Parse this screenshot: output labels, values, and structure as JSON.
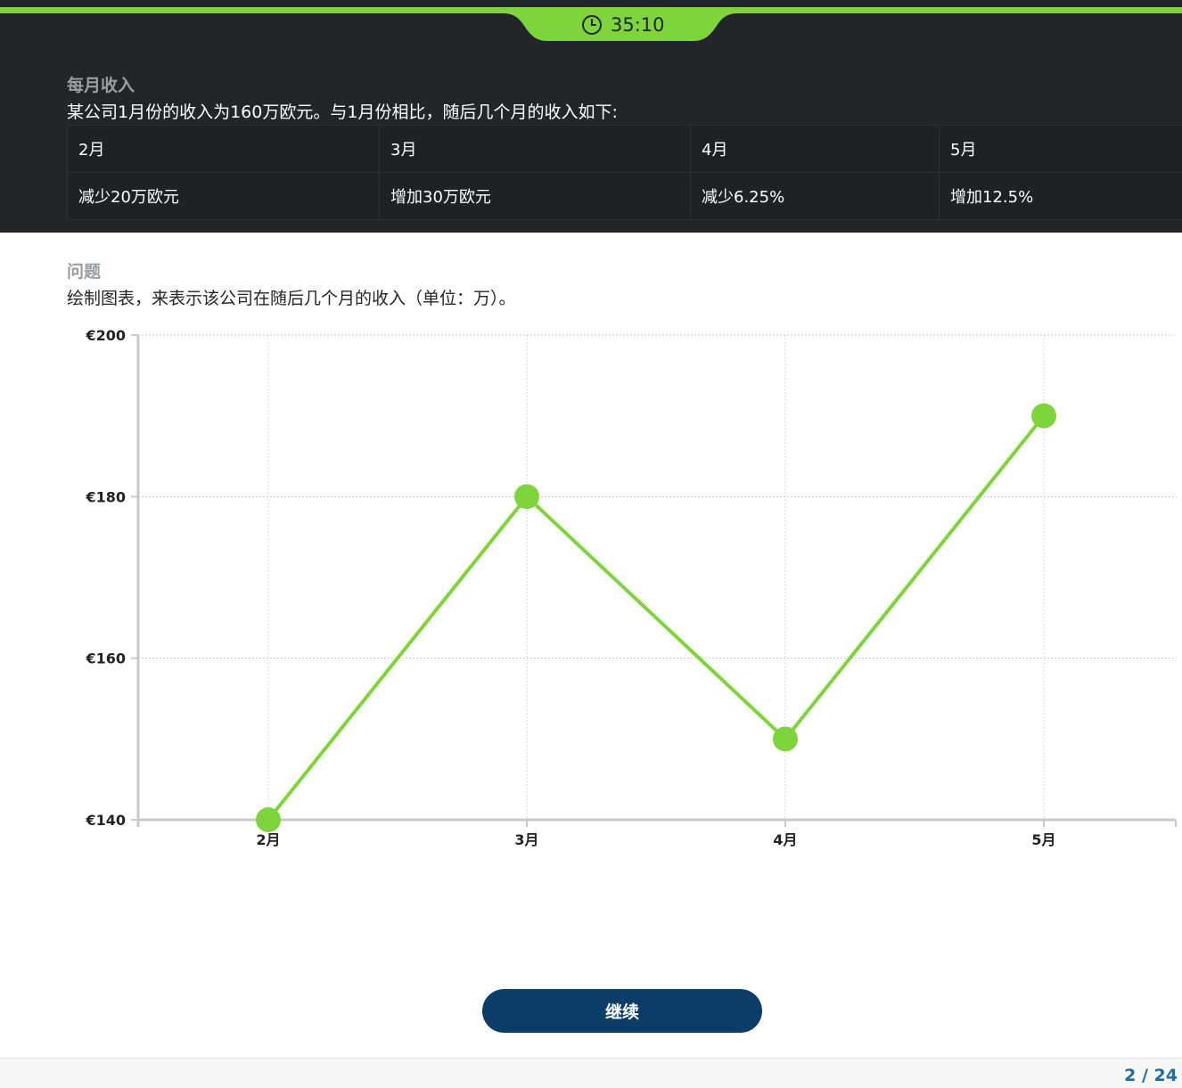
{
  "timer": {
    "value": "35:10",
    "icon": "clock-icon"
  },
  "intro": {
    "label": "每月收入",
    "text": "某公司1月份的收入为160万欧元。与1月份相比，随后几个月的收入如下:",
    "table": {
      "headers": [
        "2月",
        "3月",
        "4月",
        "5月"
      ],
      "values": [
        "减少20万欧元",
        "增加30万欧元",
        "减少6.25%",
        "增加12.5%"
      ]
    }
  },
  "question": {
    "label": "问题",
    "text": "绘制图表，来表示该公司在随后几个月的收入（单位：万）。"
  },
  "chart_data": {
    "type": "line",
    "categories": [
      "2月",
      "3月",
      "4月",
      "5月"
    ],
    "values": [
      140,
      180,
      150,
      190
    ],
    "ylim": [
      140,
      200
    ],
    "yticks": [
      140,
      160,
      180,
      200
    ],
    "ytick_labels": [
      "€140",
      "€160",
      "€180",
      "€200"
    ],
    "grid": true,
    "line_color": "#7ed43b"
  },
  "continue_button": {
    "label": "继续"
  },
  "footer": {
    "pager": "2 / 24"
  },
  "colors": {
    "accent": "#7ed43b",
    "panel": "#222629",
    "button": "#0b3d68",
    "pager": "#1b6f9a"
  }
}
